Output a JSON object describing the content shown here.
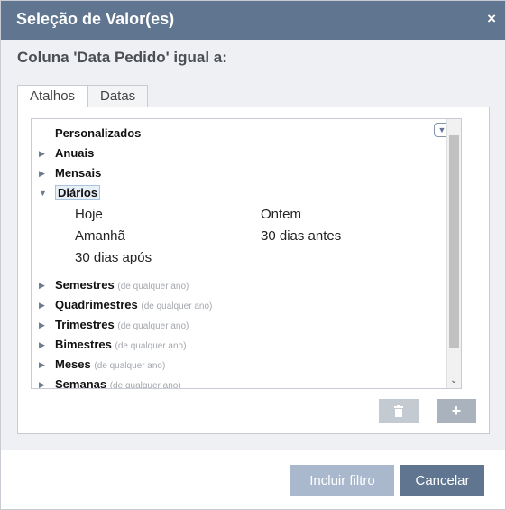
{
  "dialog": {
    "title": "Seleção de Valor(es)",
    "close_label": "×",
    "subtitle": "Coluna 'Data Pedido' igual a:"
  },
  "tabs": [
    {
      "label": "Atalhos",
      "active": true
    },
    {
      "label": "Datas",
      "active": false
    }
  ],
  "tree": {
    "nodes": [
      {
        "label": "Personalizados",
        "hint": "",
        "expanded": false,
        "has_arrow": false
      },
      {
        "label": "Anuais",
        "hint": "",
        "expanded": false,
        "has_arrow": true
      },
      {
        "label": "Mensais",
        "hint": "",
        "expanded": false,
        "has_arrow": true
      },
      {
        "label": "Diários",
        "hint": "",
        "expanded": true,
        "has_arrow": true,
        "selected": true
      },
      {
        "label": "Semestres",
        "hint": "(de qualquer ano)",
        "expanded": false,
        "has_arrow": true
      },
      {
        "label": "Quadrimestres",
        "hint": "(de qualquer ano)",
        "expanded": false,
        "has_arrow": true
      },
      {
        "label": "Trimestres",
        "hint": "(de qualquer ano)",
        "expanded": false,
        "has_arrow": true
      },
      {
        "label": "Bimestres",
        "hint": "(de qualquer ano)",
        "expanded": false,
        "has_arrow": true
      },
      {
        "label": "Meses",
        "hint": "(de qualquer ano)",
        "expanded": false,
        "has_arrow": true
      },
      {
        "label": "Semanas",
        "hint": "(de qualquer ano)",
        "expanded": false,
        "has_arrow": true
      }
    ],
    "daily_options": [
      "Hoje",
      "Ontem",
      "Amanhã",
      "30 dias antes",
      "30 dias após"
    ],
    "expand_all_icon": "chevron-down-circle-icon",
    "collapse_icon": "chevron-right-circle-icon"
  },
  "actions": {
    "delete_icon": "trash-icon",
    "add_label": "+"
  },
  "footer": {
    "include_label": "Incluir filtro",
    "cancel_label": "Cancelar"
  },
  "colors": {
    "header": "#5f7590",
    "disabled_button": "#a9b8cd",
    "primary_button": "#5f7590"
  }
}
